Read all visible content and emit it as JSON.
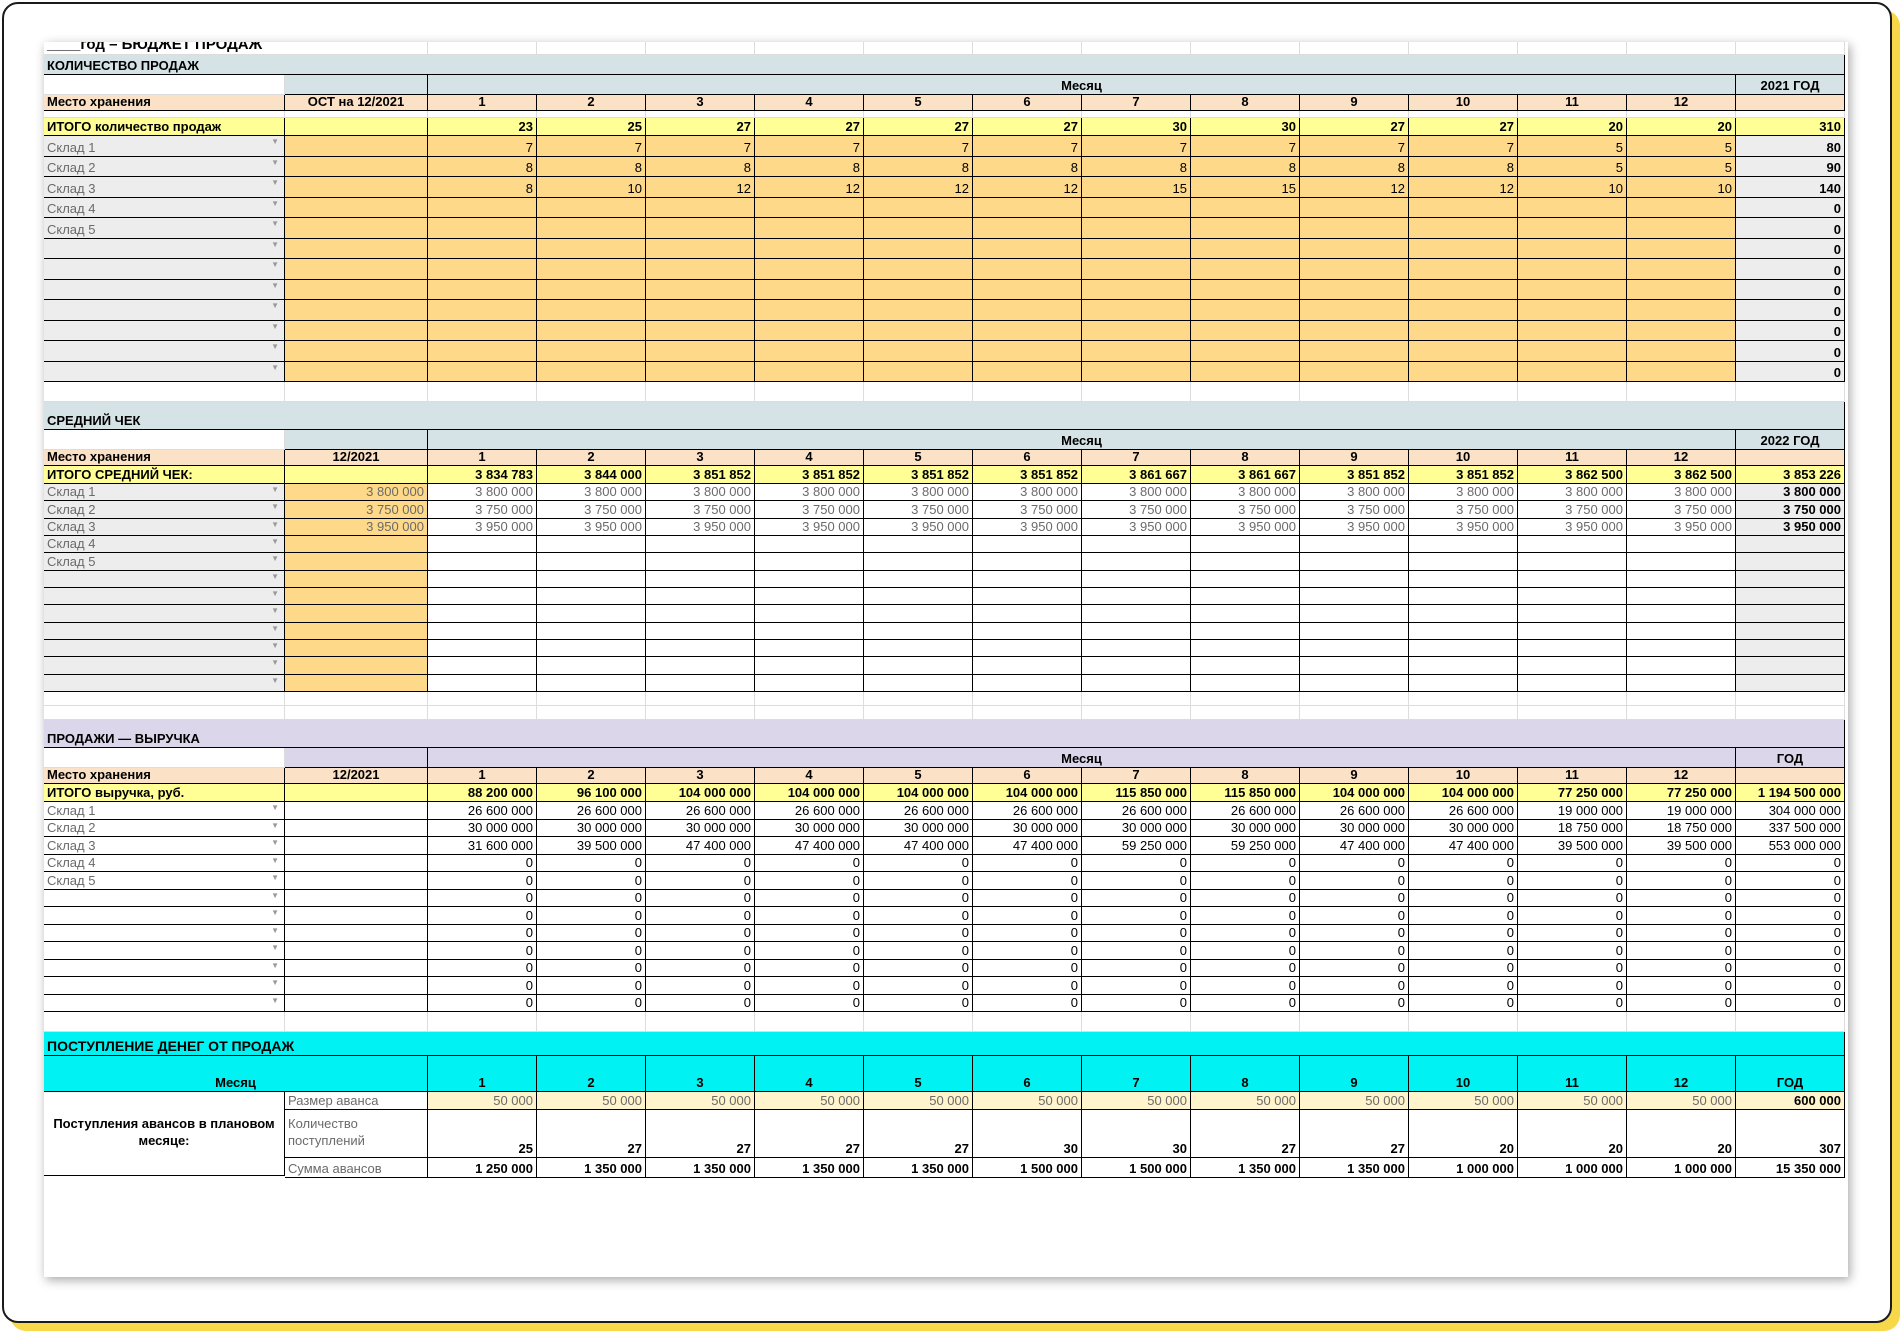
{
  "title": "____год – БЮДЖЕТ ПРОДАЖ",
  "months": [
    "1",
    "2",
    "3",
    "4",
    "5",
    "6",
    "7",
    "8",
    "9",
    "10",
    "11",
    "12"
  ],
  "colors": {
    "section1": "#d6e3e6",
    "section3": "#dbd6ea",
    "section4": "#00f2f2",
    "peach": "#fbe1c6",
    "yellow": "#ffff96",
    "orange": "#ffd98a",
    "grey": "#ededed"
  },
  "icons": {
    "dropdown": "dropdown-arrow-icon"
  },
  "quantity": {
    "title": "КОЛИЧЕСТВО ПРОДАЖ",
    "month_header": "Месяц",
    "year_header": "2021 ГОД",
    "place_label": "Место хранения",
    "col_b_label": "ОСТ на 12/2021",
    "total_label": "ИТОГО количество продаж",
    "total_values": [
      "23",
      "25",
      "27",
      "27",
      "27",
      "27",
      "30",
      "30",
      "27",
      "27",
      "20",
      "20"
    ],
    "total_year": "310",
    "rows": [
      {
        "label": "Склад 1",
        "values": [
          "7",
          "7",
          "7",
          "7",
          "7",
          "7",
          "7",
          "7",
          "7",
          "7",
          "5",
          "5"
        ],
        "year": "80"
      },
      {
        "label": "Склад 2",
        "values": [
          "8",
          "8",
          "8",
          "8",
          "8",
          "8",
          "8",
          "8",
          "8",
          "8",
          "5",
          "5"
        ],
        "year": "90"
      },
      {
        "label": "Склад 3",
        "values": [
          "8",
          "10",
          "12",
          "12",
          "12",
          "12",
          "15",
          "15",
          "12",
          "12",
          "10",
          "10"
        ],
        "year": "140"
      },
      {
        "label": "Склад 4",
        "values": [
          "",
          "",
          "",
          "",
          "",
          "",
          "",
          "",
          "",
          "",
          "",
          ""
        ],
        "year": "0"
      },
      {
        "label": "Склад 5",
        "values": [
          "",
          "",
          "",
          "",
          "",
          "",
          "",
          "",
          "",
          "",
          "",
          ""
        ],
        "year": "0"
      },
      {
        "label": "",
        "values": [
          "",
          "",
          "",
          "",
          "",
          "",
          "",
          "",
          "",
          "",
          "",
          ""
        ],
        "year": "0"
      },
      {
        "label": "",
        "values": [
          "",
          "",
          "",
          "",
          "",
          "",
          "",
          "",
          "",
          "",
          "",
          ""
        ],
        "year": "0"
      },
      {
        "label": "",
        "values": [
          "",
          "",
          "",
          "",
          "",
          "",
          "",
          "",
          "",
          "",
          "",
          ""
        ],
        "year": "0"
      },
      {
        "label": "",
        "values": [
          "",
          "",
          "",
          "",
          "",
          "",
          "",
          "",
          "",
          "",
          "",
          ""
        ],
        "year": "0"
      },
      {
        "label": "",
        "values": [
          "",
          "",
          "",
          "",
          "",
          "",
          "",
          "",
          "",
          "",
          "",
          ""
        ],
        "year": "0"
      },
      {
        "label": "",
        "values": [
          "",
          "",
          "",
          "",
          "",
          "",
          "",
          "",
          "",
          "",
          "",
          ""
        ],
        "year": "0"
      },
      {
        "label": "",
        "values": [
          "",
          "",
          "",
          "",
          "",
          "",
          "",
          "",
          "",
          "",
          "",
          ""
        ],
        "year": "0"
      }
    ]
  },
  "avg_check": {
    "title": "СРЕДНИЙ ЧЕК",
    "month_header": "Месяц",
    "year_header": "2022 ГОД",
    "place_label": "Место хранения",
    "col_b_label": "12/2021",
    "total_label": "ИТОГО СРЕДНИЙ ЧЕК:",
    "total_values": [
      "3 834 783",
      "3 844 000",
      "3 851 852",
      "3 851 852",
      "3 851 852",
      "3 851 852",
      "3 861 667",
      "3 861 667",
      "3 851 852",
      "3 851 852",
      "3 862 500",
      "3 862 500"
    ],
    "total_year": "3 853 226",
    "rows": [
      {
        "label": "Склад 1",
        "base": "3 800 000",
        "values": [
          "3 800 000",
          "3 800 000",
          "3 800 000",
          "3 800 000",
          "3 800 000",
          "3 800 000",
          "3 800 000",
          "3 800 000",
          "3 800 000",
          "3 800 000",
          "3 800 000",
          "3 800 000"
        ],
        "year": "3 800 000"
      },
      {
        "label": "Склад 2",
        "base": "3 750 000",
        "values": [
          "3 750 000",
          "3 750 000",
          "3 750 000",
          "3 750 000",
          "3 750 000",
          "3 750 000",
          "3 750 000",
          "3 750 000",
          "3 750 000",
          "3 750 000",
          "3 750 000",
          "3 750 000"
        ],
        "year": "3 750 000"
      },
      {
        "label": "Склад 3",
        "base": "3 950 000",
        "values": [
          "3 950 000",
          "3 950 000",
          "3 950 000",
          "3 950 000",
          "3 950 000",
          "3 950 000",
          "3 950 000",
          "3 950 000",
          "3 950 000",
          "3 950 000",
          "3 950 000",
          "3 950 000"
        ],
        "year": "3 950 000"
      },
      {
        "label": "Склад 4",
        "base": "",
        "values": [
          "",
          "",
          "",
          "",
          "",
          "",
          "",
          "",
          "",
          "",
          "",
          ""
        ],
        "year": ""
      },
      {
        "label": "Склад 5",
        "base": "",
        "values": [
          "",
          "",
          "",
          "",
          "",
          "",
          "",
          "",
          "",
          "",
          "",
          ""
        ],
        "year": ""
      },
      {
        "label": "",
        "base": "",
        "values": [
          "",
          "",
          "",
          "",
          "",
          "",
          "",
          "",
          "",
          "",
          "",
          ""
        ],
        "year": ""
      },
      {
        "label": "",
        "base": "",
        "values": [
          "",
          "",
          "",
          "",
          "",
          "",
          "",
          "",
          "",
          "",
          "",
          ""
        ],
        "year": ""
      },
      {
        "label": "",
        "base": "",
        "values": [
          "",
          "",
          "",
          "",
          "",
          "",
          "",
          "",
          "",
          "",
          "",
          ""
        ],
        "year": ""
      },
      {
        "label": "",
        "base": "",
        "values": [
          "",
          "",
          "",
          "",
          "",
          "",
          "",
          "",
          "",
          "",
          "",
          ""
        ],
        "year": ""
      },
      {
        "label": "",
        "base": "",
        "values": [
          "",
          "",
          "",
          "",
          "",
          "",
          "",
          "",
          "",
          "",
          "",
          ""
        ],
        "year": ""
      },
      {
        "label": "",
        "base": "",
        "values": [
          "",
          "",
          "",
          "",
          "",
          "",
          "",
          "",
          "",
          "",
          "",
          ""
        ],
        "year": ""
      },
      {
        "label": "",
        "base": "",
        "values": [
          "",
          "",
          "",
          "",
          "",
          "",
          "",
          "",
          "",
          "",
          "",
          ""
        ],
        "year": ""
      }
    ]
  },
  "revenue": {
    "title": "ПРОДАЖИ — ВЫРУЧКА",
    "month_header": "Месяц",
    "year_header": "ГОД",
    "place_label": "Место хранения",
    "col_b_label": "12/2021",
    "total_label": "ИТОГО выручка, руб.",
    "total_values": [
      "88 200 000",
      "96 100 000",
      "104 000 000",
      "104 000 000",
      "104 000 000",
      "104 000 000",
      "115 850 000",
      "115 850 000",
      "104 000 000",
      "104 000 000",
      "77 250 000",
      "77 250 000"
    ],
    "total_year": "1 194 500 000",
    "rows": [
      {
        "label": "Склад 1",
        "values": [
          "26 600 000",
          "26 600 000",
          "26 600 000",
          "26 600 000",
          "26 600 000",
          "26 600 000",
          "26 600 000",
          "26 600 000",
          "26 600 000",
          "26 600 000",
          "19 000 000",
          "19 000 000"
        ],
        "year": "304 000 000"
      },
      {
        "label": "Склад 2",
        "values": [
          "30 000 000",
          "30 000 000",
          "30 000 000",
          "30 000 000",
          "30 000 000",
          "30 000 000",
          "30 000 000",
          "30 000 000",
          "30 000 000",
          "30 000 000",
          "18 750 000",
          "18 750 000"
        ],
        "year": "337 500 000"
      },
      {
        "label": "Склад 3",
        "values": [
          "31 600 000",
          "39 500 000",
          "47 400 000",
          "47 400 000",
          "47 400 000",
          "47 400 000",
          "59 250 000",
          "59 250 000",
          "47 400 000",
          "47 400 000",
          "39 500 000",
          "39 500 000"
        ],
        "year": "553 000 000"
      },
      {
        "label": "Склад 4",
        "values": [
          "0",
          "0",
          "0",
          "0",
          "0",
          "0",
          "0",
          "0",
          "0",
          "0",
          "0",
          "0"
        ],
        "year": "0"
      },
      {
        "label": "Склад 5",
        "values": [
          "0",
          "0",
          "0",
          "0",
          "0",
          "0",
          "0",
          "0",
          "0",
          "0",
          "0",
          "0"
        ],
        "year": "0"
      },
      {
        "label": "",
        "values": [
          "0",
          "0",
          "0",
          "0",
          "0",
          "0",
          "0",
          "0",
          "0",
          "0",
          "0",
          "0"
        ],
        "year": "0"
      },
      {
        "label": "",
        "values": [
          "0",
          "0",
          "0",
          "0",
          "0",
          "0",
          "0",
          "0",
          "0",
          "0",
          "0",
          "0"
        ],
        "year": "0"
      },
      {
        "label": "",
        "values": [
          "0",
          "0",
          "0",
          "0",
          "0",
          "0",
          "0",
          "0",
          "0",
          "0",
          "0",
          "0"
        ],
        "year": "0"
      },
      {
        "label": "",
        "values": [
          "0",
          "0",
          "0",
          "0",
          "0",
          "0",
          "0",
          "0",
          "0",
          "0",
          "0",
          "0"
        ],
        "year": "0"
      },
      {
        "label": "",
        "values": [
          "0",
          "0",
          "0",
          "0",
          "0",
          "0",
          "0",
          "0",
          "0",
          "0",
          "0",
          "0"
        ],
        "year": "0"
      },
      {
        "label": "",
        "values": [
          "0",
          "0",
          "0",
          "0",
          "0",
          "0",
          "0",
          "0",
          "0",
          "0",
          "0",
          "0"
        ],
        "year": "0"
      },
      {
        "label": "",
        "values": [
          "0",
          "0",
          "0",
          "0",
          "0",
          "0",
          "0",
          "0",
          "0",
          "0",
          "0",
          "0"
        ],
        "year": "0"
      }
    ]
  },
  "cash": {
    "title": "ПОСТУПЛЕНИЕ ДЕНЕГ ОТ ПРОДАЖ",
    "month_header": "Месяц",
    "year_header": "ГОД",
    "group_label": "Поступления авансов в плановом месяце:",
    "rows": [
      {
        "label": "Размер аванса",
        "values": [
          "50 000",
          "50 000",
          "50 000",
          "50 000",
          "50 000",
          "50 000",
          "50 000",
          "50 000",
          "50 000",
          "50 000",
          "50 000",
          "50 000"
        ],
        "year": "600 000"
      },
      {
        "label": "Количество поступлений",
        "values": [
          "25",
          "27",
          "27",
          "27",
          "27",
          "30",
          "30",
          "27",
          "27",
          "20",
          "20",
          "20"
        ],
        "year": "307"
      },
      {
        "label": "Сумма авансов",
        "values": [
          "1 250 000",
          "1 350 000",
          "1 350 000",
          "1 350 000",
          "1 350 000",
          "1 500 000",
          "1 500 000",
          "1 350 000",
          "1 350 000",
          "1 000 000",
          "1 000 000",
          "1 000 000"
        ],
        "year": "15 350 000"
      }
    ]
  }
}
